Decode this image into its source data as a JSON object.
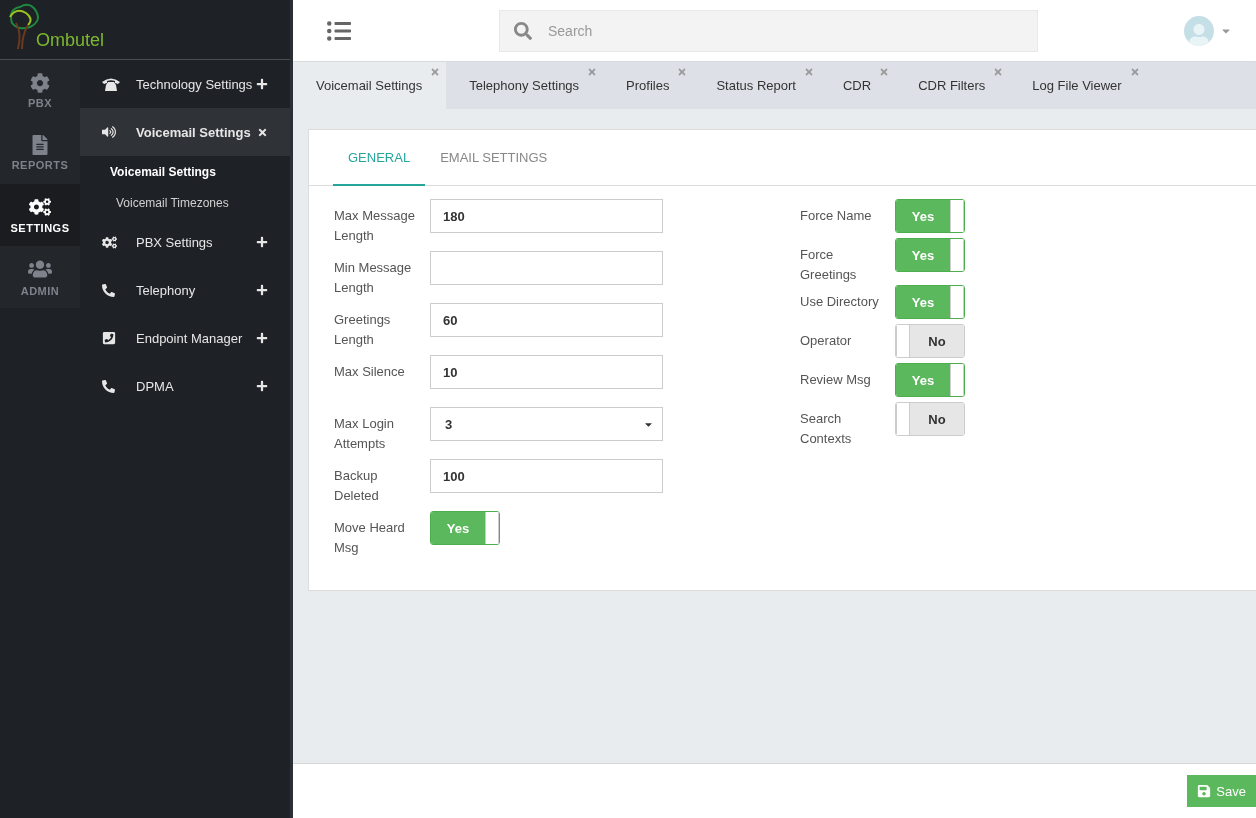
{
  "brand": {
    "name": "Ombutel"
  },
  "rail": [
    {
      "kind": "gear",
      "label": "PBX",
      "selected": false
    },
    {
      "kind": "file",
      "label": "REPORTS",
      "selected": false
    },
    {
      "kind": "gears",
      "label": "SETTINGS",
      "selected": true
    },
    {
      "kind": "users",
      "label": "ADMIN",
      "selected": false
    }
  ],
  "menu": [
    {
      "kind": "oldphone",
      "label": "Technology Settings",
      "expanded": false
    },
    {
      "kind": "speaker",
      "label": "Voicemail Settings",
      "expanded": true,
      "children": [
        {
          "label": "Voicemail Settings",
          "selected": true
        },
        {
          "label": "Voicemail Timezones",
          "selected": false
        }
      ]
    },
    {
      "kind": "gears",
      "label": "PBX Settings",
      "expanded": false
    },
    {
      "kind": "phone",
      "label": "Telephony",
      "expanded": false
    },
    {
      "kind": "phonesquare",
      "label": "Endpoint Manager",
      "expanded": false
    },
    {
      "kind": "phone",
      "label": "DPMA",
      "expanded": false
    }
  ],
  "search": {
    "placeholder": "Search"
  },
  "tabs": [
    {
      "label": "Voicemail Settings",
      "selected": true
    },
    {
      "label": "Telephony Settings",
      "selected": false
    },
    {
      "label": "Profiles",
      "selected": false
    },
    {
      "label": "Status Report",
      "selected": false
    },
    {
      "label": "CDR",
      "selected": false
    },
    {
      "label": "CDR Filters",
      "selected": false
    },
    {
      "label": "Log File Viewer",
      "selected": false
    }
  ],
  "subtabs": [
    {
      "label": "GENERAL",
      "selected": true
    },
    {
      "label": "EMAIL SETTINGS",
      "selected": false
    }
  ],
  "left_fields": [
    {
      "kind": "text",
      "label": "Max Message Length",
      "value": "180"
    },
    {
      "kind": "text",
      "label": "Min Message Length"
    },
    {
      "kind": "text",
      "label": "Greetings Length",
      "value": "60"
    },
    {
      "kind": "text",
      "label": "Max Silence",
      "value": "10"
    },
    {
      "kind": "select",
      "label": "Max Login Attempts",
      "value": "3"
    },
    {
      "kind": "text",
      "label": "Backup Deleted",
      "value": "100"
    },
    {
      "kind": "toggle",
      "label": "Move Heard Msg",
      "on": true,
      "value": "Yes"
    }
  ],
  "right_fields": [
    {
      "label": "Force Name",
      "on": true,
      "value": "Yes"
    },
    {
      "label": "Force Greetings",
      "on": true,
      "value": "Yes"
    },
    {
      "label": "Use Directory",
      "on": true,
      "value": "Yes"
    },
    {
      "label": "Operator",
      "on": false,
      "value": "No"
    },
    {
      "label": "Review Msg",
      "on": true,
      "value": "Yes"
    },
    {
      "label": "Search Contexts",
      "on": false,
      "value": "No"
    }
  ],
  "save_button": {
    "label": "Save"
  }
}
